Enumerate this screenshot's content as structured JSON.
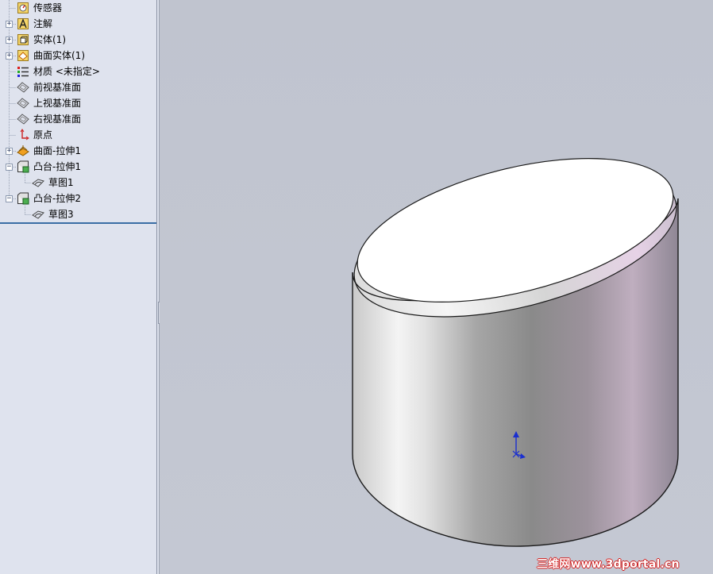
{
  "feature_tree": {
    "items": [
      {
        "label": "传感器",
        "icon": "sensor-icon",
        "expandable": false
      },
      {
        "label": "注解",
        "icon": "annotation-icon",
        "expandable": true,
        "expander": "+"
      },
      {
        "label": "实体(1)",
        "icon": "solid-body-icon",
        "expandable": true,
        "expander": "+"
      },
      {
        "label": "曲面实体(1)",
        "icon": "surface-body-icon",
        "expandable": true,
        "expander": "+"
      },
      {
        "label": "材质 <未指定>",
        "icon": "material-icon",
        "expandable": false
      },
      {
        "label": "前视基准面",
        "icon": "plane-icon",
        "expandable": false
      },
      {
        "label": "上视基准面",
        "icon": "plane-icon",
        "expandable": false
      },
      {
        "label": "右视基准面",
        "icon": "plane-icon",
        "expandable": false
      },
      {
        "label": "原点",
        "icon": "origin-icon",
        "expandable": false
      },
      {
        "label": "曲面-拉伸1",
        "icon": "surface-extrude-icon",
        "expandable": true,
        "expander": "+"
      },
      {
        "label": "凸台-拉伸1",
        "icon": "boss-extrude-icon",
        "expandable": true,
        "expander": "−"
      },
      {
        "label": "草图1",
        "icon": "sketch-icon",
        "expandable": false,
        "child": true
      },
      {
        "label": "凸台-拉伸2",
        "icon": "boss-extrude-icon",
        "expandable": true,
        "expander": "−"
      },
      {
        "label": "草图3",
        "icon": "sketch-icon",
        "expandable": false,
        "child": true
      }
    ]
  },
  "viewport": {
    "model": "cylinder-with-inclined-top",
    "triad_icon": "origin-triad-icon"
  },
  "watermark": {
    "text": "三维网www.3dportal.cn"
  },
  "colors": {
    "panel_bg": "#dfe3ee",
    "viewport_bg": "#c3c7d2",
    "selection_line": "#3a6ea5",
    "watermark_red": "#d01a1a"
  }
}
